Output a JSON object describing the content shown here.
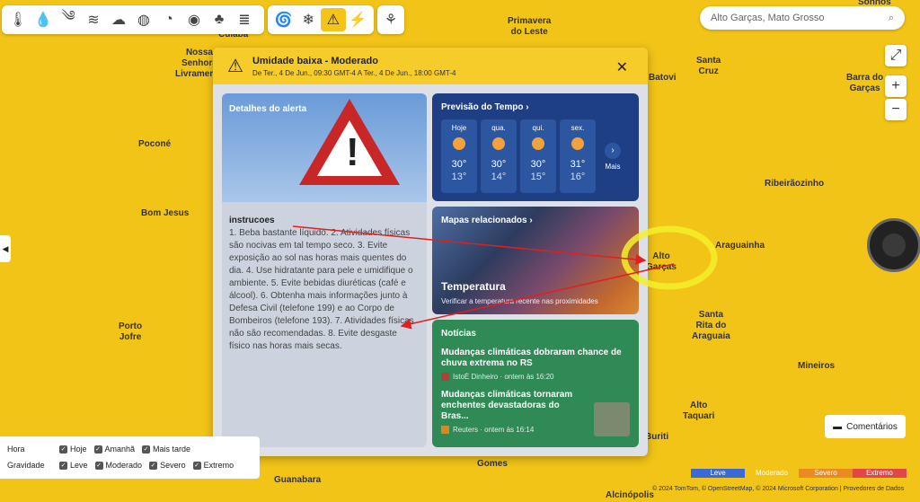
{
  "toolbar": {
    "group1": [
      "thermometer-icon",
      "raindrop-icon",
      "wind-gust-icon",
      "wind-icon",
      "cloud-icon",
      "uv-index-icon",
      "pressure-icon",
      "visibility-icon",
      "leaf-icon",
      "fog-icon"
    ],
    "group2": [
      "hurricane-icon",
      "snowflake-icon",
      "warning-icon",
      "lightning-icon"
    ],
    "group3": [
      "plant-icon"
    ]
  },
  "search": {
    "value": "Alto Garças, Mato Grosso"
  },
  "map_labels": [
    {
      "text": "Cuiabá"
    },
    {
      "text": "Primavera\ndo Leste"
    },
    {
      "text": "Sonhos"
    },
    {
      "text": "Nossa\nSenhora\nLivramento"
    },
    {
      "text": "Batovi"
    },
    {
      "text": "Santa\nCruz"
    },
    {
      "text": "Barra do\nGarças"
    },
    {
      "text": "Poconé"
    },
    {
      "text": "Ribeirãozinho"
    },
    {
      "text": "Bom Jesus"
    },
    {
      "text": "Araguainha"
    },
    {
      "text": "Alto\nGarças"
    },
    {
      "text": "Porto\nJofre"
    },
    {
      "text": "Santa\nRita do\nAraguaia"
    },
    {
      "text": "Mineiros"
    },
    {
      "text": "Alto\nTaquari"
    },
    {
      "text": "Buriti"
    },
    {
      "text": "Gomes"
    },
    {
      "text": "Guanabara"
    },
    {
      "text": "Alcinópolis"
    }
  ],
  "alert": {
    "title": "Umidade baixa - Moderado",
    "period": "De Ter., 4 De Jun., 09:30 GMT-4 A Ter., 4 De Jun., 18:00 GMT-4"
  },
  "details": {
    "title": "Detalhes do alerta",
    "heading": "instrucoes",
    "body": "1. Beba bastante líquido. 2. Atividades físicas são nocivas em tal tempo seco. 3. Evite exposição ao sol nas horas mais quentes do dia. 4. Use hidratante para pele e umidifique o ambiente. 5. Evite bebidas diuréticas (café e álcool). 6. Obtenha mais informações junto à Defesa Civil (telefone 199) e ao Corpo de Bombeiros (telefone 193). 7. Atividades físicas não são recomendadas. 8. Evite desgaste físico nas horas mais secas."
  },
  "forecast": {
    "title": "Previsão do Tempo ›",
    "days": [
      {
        "label": "Hoje",
        "hi": "30°",
        "lo": "13°"
      },
      {
        "label": "qua.",
        "hi": "30°",
        "lo": "14°"
      },
      {
        "label": "qui.",
        "hi": "30°",
        "lo": "15°"
      },
      {
        "label": "sex.",
        "hi": "31°",
        "lo": "16°"
      }
    ],
    "more": "Mais"
  },
  "maps": {
    "title": "Mapas relacionados ›",
    "map_title": "Temperatura",
    "map_desc": "Verificar a temperatura recente nas proximidades"
  },
  "news": {
    "title": "Notícias",
    "items": [
      {
        "title": "Mudanças climáticas dobraram chance de chuva extrema no RS",
        "meta": "IstoÉ Dinheiro · ontem às 16:20"
      },
      {
        "title": "Mudanças climáticas tornaram enchentes devastadoras do Bras...",
        "meta": "Reuters · ontem às 16:14"
      }
    ]
  },
  "filters": {
    "hora_label": "Hora",
    "hora_options": [
      "Hoje",
      "Amanhã",
      "Mais tarde"
    ],
    "gravidade_label": "Gravidade",
    "gravidade_options": [
      "Leve",
      "Moderado",
      "Severo",
      "Extremo"
    ]
  },
  "comments": "Comentários",
  "legend": [
    {
      "label": "Leve",
      "color": "#3a6ad6"
    },
    {
      "label": "Moderado",
      "color": "#f2c417"
    },
    {
      "label": "Severo",
      "color": "#e98a23"
    },
    {
      "label": "Extremo",
      "color": "#e04848"
    }
  ],
  "copyright": "© 2024 TomTom, © OpenStreetMap, © 2024 Microsoft Corporation | Provedores de Dados"
}
